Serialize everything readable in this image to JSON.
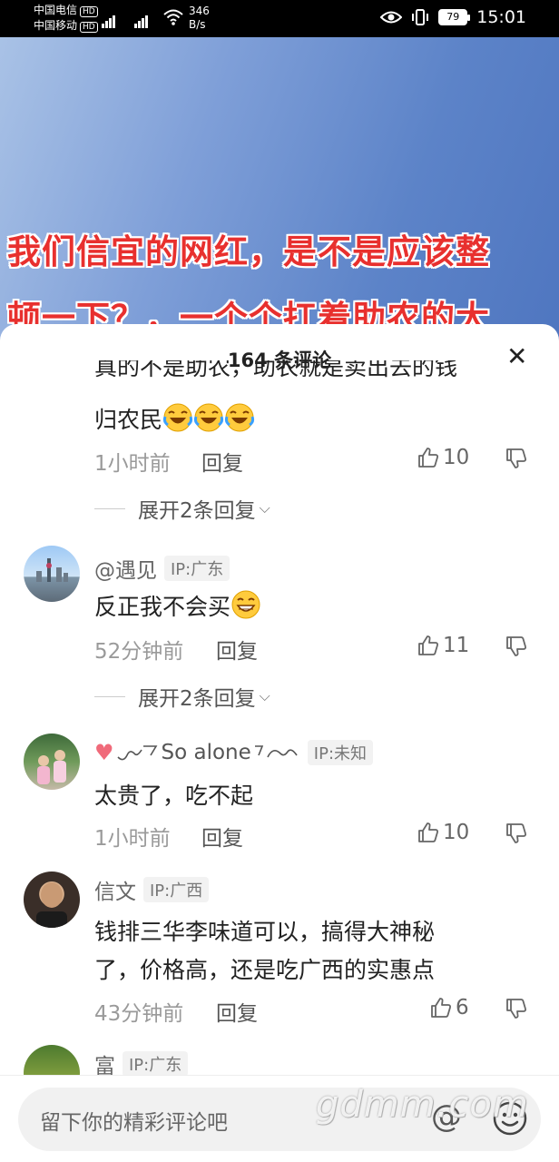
{
  "status_bar": {
    "carrier1": "中国电信",
    "carrier2": "中国移动",
    "hd": "HD",
    "net_type": "4G",
    "net_speed": "346",
    "net_unit": "B/s",
    "battery": "79",
    "time": "15:01"
  },
  "video": {
    "caption_line1": "我们信宜的网红，是不是应该整",
    "caption_line2": "顿一下？，一个个扛着助农的大"
  },
  "sheet": {
    "title": "164 条评论",
    "close_icon": "close-icon"
  },
  "comments": [
    {
      "text_partial": "真的不是助农，助农就是卖出去的钱",
      "text": "归农民",
      "emoji": "laugh-cry-emoji",
      "time": "1小时前",
      "reply": "回复",
      "likes": "10",
      "expand": "展开2条回复"
    },
    {
      "name": "@遇见",
      "ip": "IP:广东",
      "text": "反正我不会买",
      "emoji": "grin-emoji",
      "time": "52分钟前",
      "reply": "回复",
      "likes": "11",
      "expand": "展开2条回复"
    },
    {
      "name": "So alone",
      "ip": "IP:未知",
      "text": "太贵了，吃不起",
      "time": "1小时前",
      "reply": "回复",
      "likes": "10"
    },
    {
      "name": "信文",
      "ip": "IP:广西",
      "text_line1": "钱排三华李味道可以，搞得大神秘",
      "text_line2": "了，价格高，还是吃广西的实惠点",
      "time": "43分钟前",
      "reply": "回复",
      "likes": "6"
    },
    {
      "name": "富",
      "ip": "IP:广东"
    }
  ],
  "input": {
    "placeholder": "留下你的精彩评论吧",
    "at": "@",
    "emoji_icon": "smile-icon"
  },
  "watermark": "gdmm.com"
}
